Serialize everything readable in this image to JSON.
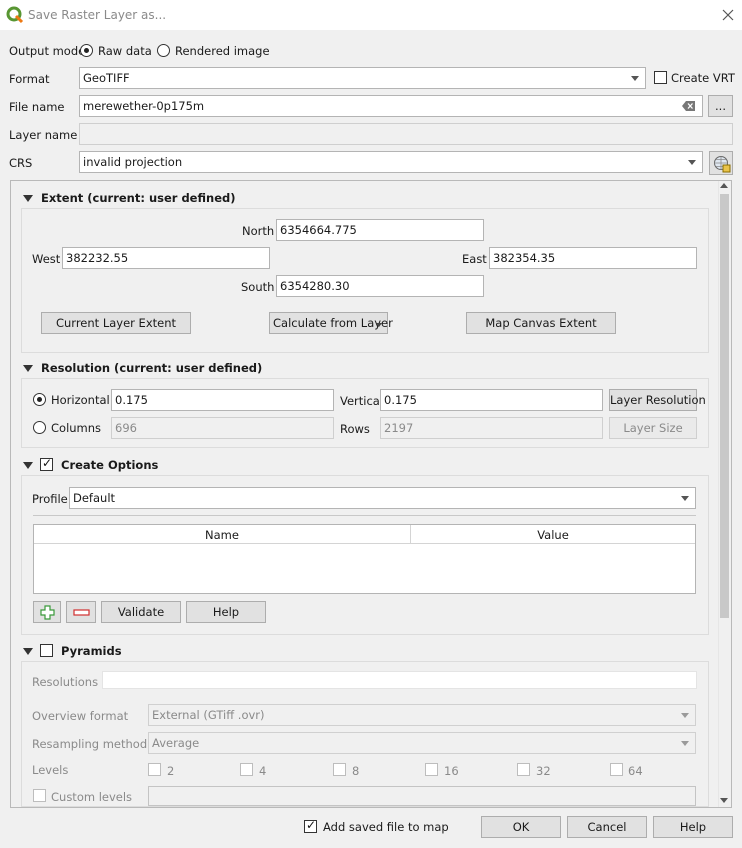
{
  "window": {
    "title": "Save Raster Layer as..."
  },
  "output_mode": {
    "label": "Output mode",
    "raw": "Raw data",
    "rendered": "Rendered image",
    "selected": "raw"
  },
  "format": {
    "label": "Format",
    "value": "GeoTIFF",
    "create_vrt": "Create VRT"
  },
  "file_name": {
    "label": "File name",
    "value": "merewether-0p175m",
    "browse": "..."
  },
  "layer_name": {
    "label": "Layer name",
    "value": ""
  },
  "crs": {
    "label": "CRS",
    "value": "invalid projection"
  },
  "extent": {
    "title": "Extent (current: user defined)",
    "north_label": "North",
    "north": "6354664.775",
    "west_label": "West",
    "west": "382232.55",
    "east_label": "East",
    "east": "382354.35",
    "south_label": "South",
    "south": "6354280.30",
    "current_layer_btn": "Current Layer Extent",
    "calc_btn": "Calculate from Layer",
    "map_canvas_btn": "Map Canvas Extent"
  },
  "resolution": {
    "title": "Resolution (current: user defined)",
    "horizontal_label": "Horizontal",
    "horizontal": "0.175",
    "vertical_label": "Vertical",
    "vertical": "0.175",
    "layer_res_btn": "Layer Resolution",
    "columns_label": "Columns",
    "columns": "696",
    "rows_label": "Rows",
    "rows": "2197",
    "layer_size_btn": "Layer Size"
  },
  "create_options": {
    "title": "Create Options",
    "profile_label": "Profile",
    "profile": "Default",
    "col_name": "Name",
    "col_value": "Value",
    "validate_btn": "Validate",
    "help_btn": "Help"
  },
  "pyramids": {
    "title": "Pyramids",
    "resolutions_label": "Resolutions",
    "overview_label": "Overview format",
    "overview": "External (GTiff .ovr)",
    "resampling_label": "Resampling method",
    "resampling": "Average",
    "levels_label": "Levels",
    "levels": [
      "2",
      "4",
      "8",
      "16",
      "32",
      "64"
    ],
    "custom_levels": "Custom levels"
  },
  "footer": {
    "add_to_map": "Add saved file to map",
    "ok": "OK",
    "cancel": "Cancel",
    "help": "Help"
  },
  "colors": {
    "qgis_green": "#589632",
    "qgis_yellow": "#ee7913",
    "add_green": "#3a9a3a",
    "remove_red": "#d03030"
  }
}
